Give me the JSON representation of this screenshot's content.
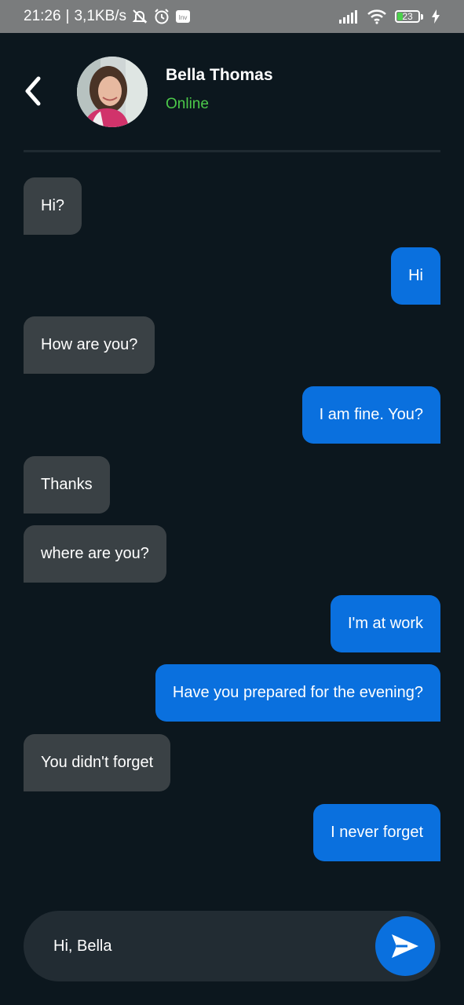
{
  "status_bar": {
    "time": "21:26",
    "separator": "|",
    "network_speed": "3,1KB/s",
    "battery_level": "23",
    "icons": [
      "mute-bell-icon",
      "alarm-icon",
      "app-icon",
      "signal-icon",
      "wifi-icon",
      "battery-icon",
      "charging-icon"
    ]
  },
  "header": {
    "back_icon": "chevron-left-icon",
    "contact_name": "Bella Thomas",
    "contact_status": "Online"
  },
  "messages": [
    {
      "direction": "in",
      "text": "Hi?"
    },
    {
      "direction": "out",
      "text": "Hi"
    },
    {
      "direction": "in",
      "text": "How are you?"
    },
    {
      "direction": "out",
      "text": "I am fine. You?"
    },
    {
      "direction": "in",
      "text": "Thanks"
    },
    {
      "direction": "in",
      "text": "where are you?"
    },
    {
      "direction": "out",
      "text": "I'm at work"
    },
    {
      "direction": "out",
      "text": "Have you prepared for the evening?"
    },
    {
      "direction": "in",
      "text": "You didn't forget"
    },
    {
      "direction": "out",
      "text": "I never forget"
    }
  ],
  "composer": {
    "value": "Hi, Bella",
    "send_icon": "send-icon"
  },
  "colors": {
    "background": "#0c171e",
    "incoming_bubble": "#3a4145",
    "outgoing_bubble": "#0a70de",
    "online": "#4cc94a",
    "status_bar": "#7a7c7d"
  }
}
